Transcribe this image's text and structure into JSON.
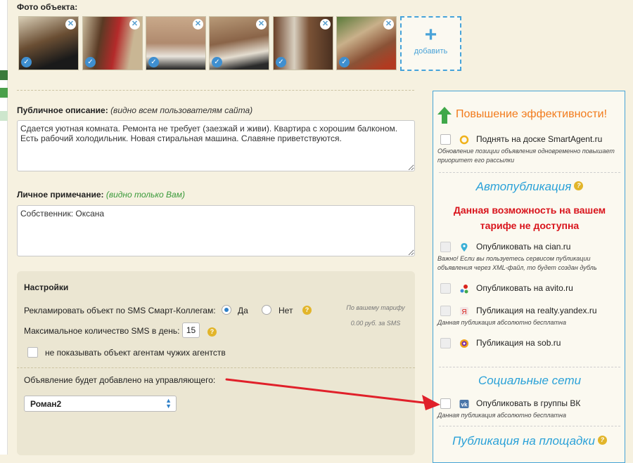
{
  "photos": {
    "title": "Фото объекта:",
    "add_label": "добавить",
    "items": [
      {
        "name": "photo-1"
      },
      {
        "name": "photo-2"
      },
      {
        "name": "photo-3"
      },
      {
        "name": "photo-4"
      },
      {
        "name": "photo-5"
      },
      {
        "name": "photo-6"
      }
    ]
  },
  "public_description": {
    "label": "Публичное описание:",
    "note": "(видно всем пользователям сайта)",
    "value": "Сдается уютная комната. Ремонта не требует (заезжай и живи). Квартира с хорошим балконом. Есть рабочий холодильник. Новая стиральная машина. Славяне приветствуются."
  },
  "private_note": {
    "label": "Личное примечание:",
    "note": "(видно только Вам)",
    "value": "Собственник: Оксана"
  },
  "settings": {
    "title": "Настройки",
    "sms_advertise_label": "Рекламировать объект по SMS Смарт-Коллегам:",
    "yes": "Да",
    "no": "Нет",
    "max_sms_label": "Максимальное количество SMS в день:",
    "max_sms_value": "15",
    "hide_agents_label": "не показывать объект агентам чужих агентств",
    "tariff_note_line1": "По вашему тарифу",
    "tariff_note_line2": "0.00 руб. за SMS",
    "manager_label": "Объявление будет добавлено на управляющего:",
    "manager_value": "Роман2"
  },
  "right_panel": {
    "efficiency_title": "Повышение эффективности!",
    "raise_label": "Поднять на доске SmartAgent.ru",
    "raise_note": "Обновление позиции объявления одновременно повышает приоритет его рассылки",
    "autopub_title": "Автопубликация",
    "warning_line1": "Данная возможность на вашем",
    "warning_line2": "тарифе не доступна",
    "cian_label": "Опубликовать на cian.ru",
    "cian_note": "Важно! Если вы пользуетесь сервисом публикации объявления через XML-файл, то будет создан дубль",
    "avito_label": "Опубликовать на avito.ru",
    "yandex_label": "Публикация на realty.yandex.ru",
    "yandex_note": "Данная публикация абсолютно бесплатна",
    "sob_label": "Публикация на sob.ru",
    "social_title": "Социальные сети",
    "vk_label": "Опубликовать в группы ВК",
    "vk_note": "Данная публикация абсолютно бесплатна",
    "platforms_title": "Публикация на площадки"
  },
  "colors": {
    "accent_blue": "#2aa1d8",
    "warning_red": "#d9141c",
    "efficiency_orange": "#f27b1c",
    "annotation_arrow": "#e0202a"
  }
}
